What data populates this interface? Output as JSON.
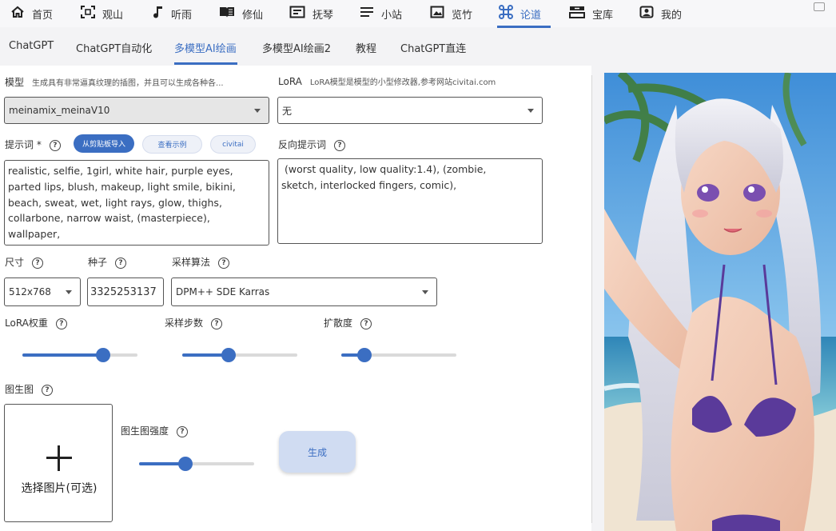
{
  "top_nav": {
    "items": [
      {
        "label": "首页",
        "icon": "home-icon"
      },
      {
        "label": "观山",
        "icon": "scan-icon"
      },
      {
        "label": "听雨",
        "icon": "music-note-icon"
      },
      {
        "label": "修仙",
        "icon": "book-icon"
      },
      {
        "label": "抚琴",
        "icon": "card-icon"
      },
      {
        "label": "小站",
        "icon": "menu-icon"
      },
      {
        "label": "览竹",
        "icon": "image-icon"
      },
      {
        "label": "论道",
        "icon": "command-icon"
      },
      {
        "label": "宝库",
        "icon": "archive-icon"
      },
      {
        "label": "我的",
        "icon": "user-icon"
      }
    ],
    "active_index": 7
  },
  "sub_nav": {
    "items": [
      "ChatGPT",
      "ChatGPT自动化",
      "多模型AI绘画",
      "多模型AI绘画2",
      "教程",
      "ChatGPT直连"
    ],
    "active_index": 2
  },
  "model": {
    "label": "模型",
    "hint": "生成具有非常逼真纹理的插图，并且可以生成各种各...",
    "value": "meinamix_meinaV10"
  },
  "lora": {
    "label": "LoRA",
    "hint": "LoRA模型是模型的小型修改器,参考网站civitai.com",
    "value": "无"
  },
  "prompt": {
    "label": "提示词 *",
    "btn_import": "从剪贴板导入",
    "btn_example": "查看示例",
    "btn_civitai": "civitai",
    "value": "realistic, selfie, 1girl, white hair, purple eyes,\nparted lips, blush, makeup, light smile, bikini,\nbeach, sweat, wet, light rays, glow, thighs,\ncollarbone, narrow waist, (masterpiece),\nwallpaper,"
  },
  "negative_prompt": {
    "label": "反向提示词",
    "value": " (worst quality, low quality:1.4), (zombie,\nsketch, interlocked fingers, comic),"
  },
  "size": {
    "label": "尺寸",
    "value": "512x768"
  },
  "seed": {
    "label": "种子",
    "value": "3325253137"
  },
  "sampler": {
    "label": "采样算法",
    "value": "DPM++ SDE Karras"
  },
  "lora_weight": {
    "label": "LoRA权重",
    "level": 0.7
  },
  "steps": {
    "label": "采样步数",
    "level": 0.4
  },
  "cfg": {
    "label": "扩散度",
    "level": 0.2
  },
  "img2img": {
    "label": "图生图",
    "upload_label": "选择图片(可选)"
  },
  "img2img_strength": {
    "label": "图生图强度",
    "level": 0.4
  },
  "generate_button": "生成",
  "colors": {
    "accent": "#3b6ec2",
    "panel": "#ffffff",
    "background": "#f3f3f5"
  }
}
